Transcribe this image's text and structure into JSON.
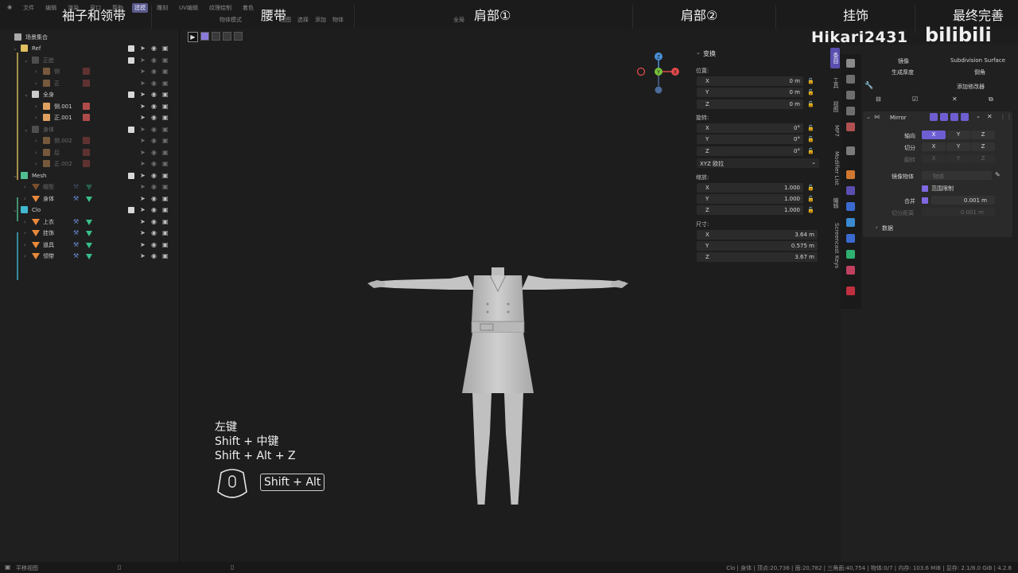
{
  "top_menu": {
    "items": [
      "文件",
      "编辑",
      "渲染",
      "窗口",
      "帮助"
    ],
    "workspace_tabs": [
      "建模",
      "雕刻",
      "UV编辑",
      "纹理绘制",
      "着色"
    ],
    "active_workspace": "建模"
  },
  "chapters": [
    "袖子和领带",
    "腰带",
    "肩部①",
    "肩部②",
    "挂饰",
    "最终完善"
  ],
  "viewport_header": {
    "mode": "物体模式",
    "menus": [
      "视图",
      "选择",
      "添加",
      "物体"
    ],
    "transform_orientation": "全局"
  },
  "outliner": {
    "header": "场景集合",
    "rows": [
      {
        "label": "Ref",
        "level": 0,
        "type": "collection",
        "color": "#e0c060",
        "dim": false,
        "checked": true
      },
      {
        "label": "正脸",
        "level": 1,
        "type": "collection",
        "color": "#888888",
        "dim": true,
        "checked": true
      },
      {
        "label": "侧",
        "level": 2,
        "type": "image",
        "color": "#e0a060",
        "dim": true,
        "checked": false
      },
      {
        "label": "正",
        "level": 2,
        "type": "image",
        "color": "#e0a060",
        "dim": true,
        "checked": false
      },
      {
        "label": "全身",
        "level": 1,
        "type": "collection",
        "color": "#cccccc",
        "dim": false,
        "checked": true
      },
      {
        "label": "侧.001",
        "level": 2,
        "type": "image",
        "color": "#e0a060",
        "dim": false,
        "checked": false
      },
      {
        "label": "正.001",
        "level": 2,
        "type": "image",
        "color": "#e0a060",
        "dim": false,
        "checked": false
      },
      {
        "label": "身体",
        "level": 1,
        "type": "collection",
        "color": "#888888",
        "dim": true,
        "checked": true
      },
      {
        "label": "侧.002",
        "level": 2,
        "type": "image",
        "color": "#e0a060",
        "dim": true,
        "checked": false
      },
      {
        "label": "后",
        "level": 2,
        "type": "image",
        "color": "#e0a060",
        "dim": true,
        "checked": false
      },
      {
        "label": "正.002",
        "level": 2,
        "type": "image",
        "color": "#e0a060",
        "dim": true,
        "checked": false
      },
      {
        "label": "Mesh",
        "level": 0,
        "type": "collection",
        "color": "#50c090",
        "dim": false,
        "checked": true
      },
      {
        "label": "帽型",
        "level": 1,
        "type": "mesh",
        "color": "#e8893b",
        "dim": true,
        "checked": false
      },
      {
        "label": "身体",
        "level": 1,
        "type": "mesh",
        "color": "#e8893b",
        "dim": false,
        "checked": false
      },
      {
        "label": "Clo",
        "level": 0,
        "type": "collection",
        "color": "#40b8d0",
        "dim": false,
        "checked": true
      },
      {
        "label": "上衣",
        "level": 1,
        "type": "mesh",
        "color": "#e8893b",
        "dim": false,
        "checked": false
      },
      {
        "label": "挂饰",
        "level": 1,
        "type": "mesh",
        "color": "#e8893b",
        "dim": false,
        "checked": false
      },
      {
        "label": "道具",
        "level": 1,
        "type": "mesh",
        "color": "#e8893b",
        "dim": false,
        "checked": false
      },
      {
        "label": "领带",
        "level": 1,
        "type": "mesh",
        "color": "#e8893b",
        "dim": false,
        "checked": false
      }
    ]
  },
  "gizmo": {
    "x_label": "X",
    "y_label": "Y",
    "z_label": "Z"
  },
  "npanel": {
    "title": "变换",
    "location_label": "位置:",
    "location": [
      {
        "axis": "X",
        "value": "0 m"
      },
      {
        "axis": "Y",
        "value": "0 m"
      },
      {
        "axis": "Z",
        "value": "0 m"
      }
    ],
    "rotation_label": "旋转:",
    "rotation": [
      {
        "axis": "X",
        "value": "0°"
      },
      {
        "axis": "Y",
        "value": "0°"
      },
      {
        "axis": "Z",
        "value": "0°"
      }
    ],
    "rotation_mode": "XYZ 欧拉",
    "scale_label": "缩放:",
    "scale": [
      {
        "axis": "X",
        "value": "1.000"
      },
      {
        "axis": "Y",
        "value": "1.000"
      },
      {
        "axis": "Z",
        "value": "1.000"
      }
    ],
    "dimensions_label": "尺寸:",
    "dimensions": [
      {
        "axis": "X",
        "value": "3.64 m"
      },
      {
        "axis": "Y",
        "value": "0.575 m"
      },
      {
        "axis": "Z",
        "value": "3.67 m"
      }
    ]
  },
  "vertical_tabs": [
    "条目",
    "工具",
    "视图",
    "MP7",
    "Modifier List",
    "编辑",
    "Screencast Keys"
  ],
  "properties": {
    "quick_row1": [
      "镜像",
      "Subdivision Surface"
    ],
    "quick_row2": [
      "生成厚度",
      "倒角"
    ],
    "add_modifier": "添加修改器",
    "modifier_name": "Mirror",
    "axis_label": "轴向",
    "bisect_label": "切分",
    "flip_label": "翻转",
    "axes": [
      "X",
      "Y",
      "Z"
    ],
    "mirror_object_label": "镜像物体",
    "mirror_object_placeholder": "物体",
    "clipping_label": "范围限制",
    "merge_label": "合并",
    "merge_value": "0.001 m",
    "bisect_distance_label": "切分距离",
    "bisect_distance_value": "0.001 m",
    "data_label": "数据"
  },
  "branding": {
    "watermark": "Hikari2431",
    "logo": "bilibili"
  },
  "key_overlay": {
    "lines": [
      "左键",
      "Shift + 中键",
      "Shift + Alt + Z"
    ],
    "badge": "Shift + Alt"
  },
  "statusbar": {
    "left": "平移视图",
    "right": "Clo | 身体 | 顶点:20,736 | 面:20,782 | 三角面:40,754 | 物体:0/7 | 内存: 103.6 MiB | 显存: 2.1/8.0 GiB | 4.2.8"
  },
  "colors": {
    "accent": "#6d5fd1",
    "background": "#1d1d1d",
    "mesh_icon": "#e8893b"
  }
}
